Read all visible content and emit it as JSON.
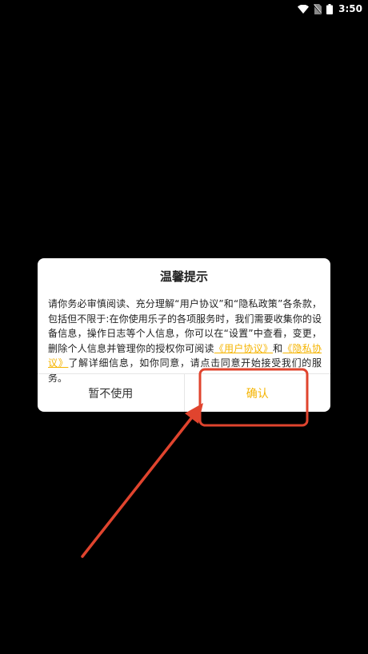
{
  "status_bar": {
    "time": "3:50",
    "icons": [
      "wifi-icon",
      "no-sim-icon",
      "battery-icon"
    ]
  },
  "dialog": {
    "title": "温馨提示",
    "body_part1": "请你务必审慎阅读、充分理解“用户协议”和“隐私政策”各条款，包括但不限于:在你使用乐子的各项服务时，我们需要收集你的设备信息，操作日志等个人信息，你可以在“设置”中查看，变更，删除个人信息并管理你的授权你可阅读",
    "link_user_agreement": "《用户协议》",
    "body_and": "和",
    "link_privacy_policy": "《隐私协议》",
    "body_part2": "了解详细信息，如你同意，请点击同意开始接受我们的服务。",
    "cancel_label": "暂不使用",
    "confirm_label": "确认"
  },
  "colors": {
    "background": "#000000",
    "accent": "#f5b400",
    "annotation": "#e0442e"
  }
}
